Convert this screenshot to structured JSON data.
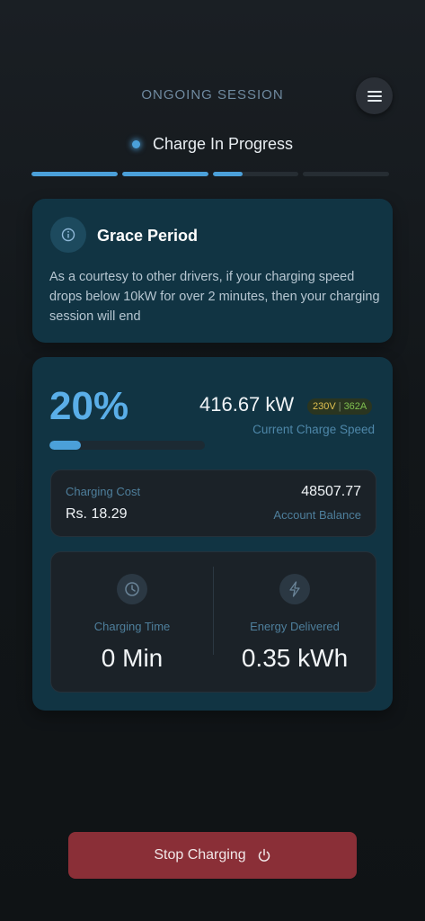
{
  "header": {
    "title": "ONGOING SESSION",
    "menu_icon": "menu-icon"
  },
  "status": {
    "text": "Charge In Progress",
    "steps_total": 4,
    "steps_fill": [
      1,
      1,
      0.35,
      0
    ]
  },
  "grace": {
    "title": "Grace Period",
    "body": "As a courtesy to other drivers, if your charging speed drops below 10kW for over 2 minutes, then your charging session will end",
    "icon": "info-icon"
  },
  "charge": {
    "percent": "20%",
    "percent_value": 0.2,
    "speed": "416.67 kW",
    "voltage": "230V",
    "current": "362A",
    "speed_label": "Current Charge Speed"
  },
  "cost": {
    "label": "Charging Cost",
    "value": "Rs. 18.29",
    "balance": "48507.77",
    "balance_label": "Account Balance"
  },
  "stats": {
    "time_label": "Charging Time",
    "time_value": "0 Min",
    "time_icon": "clock-icon",
    "energy_label": "Energy Delivered",
    "energy_value": "0.35 kWh",
    "energy_icon": "lightning-icon"
  },
  "actions": {
    "stop_label": "Stop Charging",
    "stop_icon": "power-icon"
  },
  "colors": {
    "accent": "#4ba0d9",
    "danger": "#8a2f37",
    "card": "#113443"
  }
}
